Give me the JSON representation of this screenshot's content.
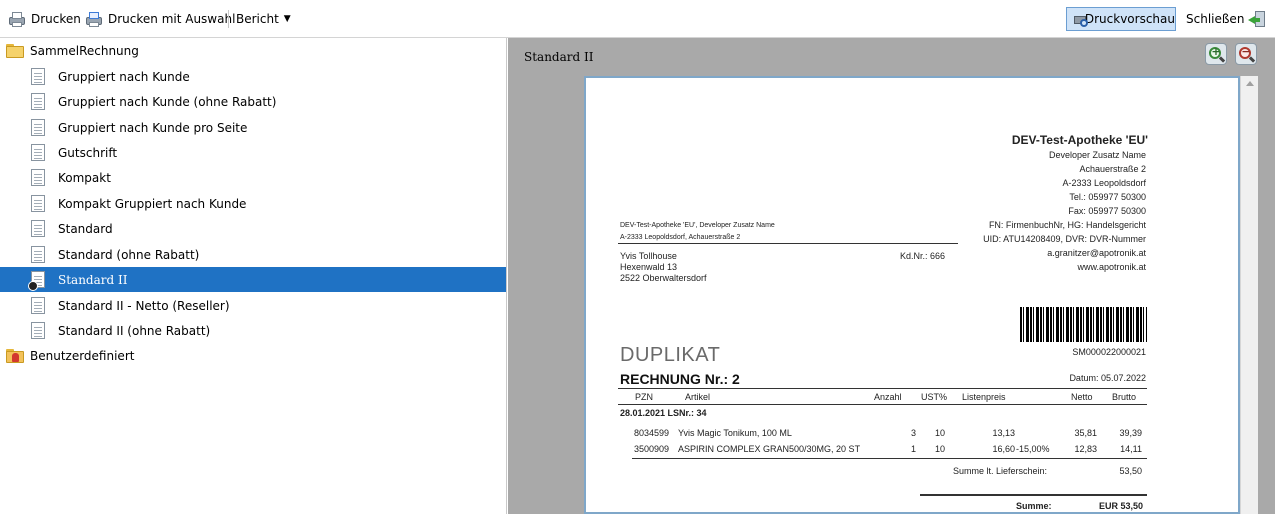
{
  "toolbar": {
    "print_label": "Drucken",
    "print_selection_label": "Drucken mit Auswahl",
    "report_label": "Bericht",
    "preview_label": "Druckvorschau",
    "close_label": "Schließen"
  },
  "tree": {
    "group_label": "SammelRechnung",
    "items": [
      "Gruppiert nach Kunde",
      "Gruppiert nach Kunde (ohne Rabatt)",
      "Gruppiert nach Kunde pro Seite",
      "Gutschrift",
      "Kompakt",
      "Kompakt Gruppiert nach Kunde",
      "Standard",
      "Standard (ohne Rabatt)",
      "Standard II",
      "Standard II - Netto (Reseller)",
      "Standard II (ohne Rabatt)"
    ],
    "selected": "Standard II",
    "user_group_label": "Benutzerdefiniert"
  },
  "preview": {
    "title": "Standard II"
  },
  "invoice": {
    "company": "DEV-Test-Apotheke 'EU'",
    "company_lines": [
      "Developer Zusatz Name",
      "Achauerstraße 2",
      "A-2333 Leopoldsdorf",
      "Tel.: 059977 50300",
      "Fax: 059977 50300",
      "FN: FirmenbuchNr, HG: Handelsgericht",
      "UID: ATU14208409, DVR: DVR-Nummer",
      "a.granitzer@apotronik.at",
      "www.apotronik.at"
    ],
    "sender_line": "DEV-Test-Apotheke 'EU', Developer Zusatz Name",
    "sender_address": "A-2333 Leopoldsdorf, Achauerstraße 2",
    "recipient": [
      "Yvis Tollhouse",
      "Hexenwald 13",
      "2522 Oberwaltersdorf"
    ],
    "customer_no": "Kd.Nr.: 666",
    "barcode_text": "SM000022000021",
    "duplicate": "DUPLIKAT",
    "invoice_title": "RECHNUNG Nr.: 2",
    "date": "Datum: 05.07.2022",
    "headers": [
      "PZN",
      "Artikel",
      "Anzahl",
      "UST%",
      "Listenpreis",
      "Netto",
      "Brutto"
    ],
    "delivery_header": "28.01.2021 LSNr.: 34",
    "rows": [
      {
        "pzn": "8034599",
        "article": "Yvis Magic Tonikum, 100 ML",
        "qty": "3",
        "vat": "10",
        "list_price": "13,13",
        "discount": "",
        "net": "35,81",
        "gross": "39,39"
      },
      {
        "pzn": "3500909",
        "article": "ASPIRIN COMPLEX GRAN500/30MG, 20 ST",
        "qty": "1",
        "vat": "10",
        "list_price": "16,60",
        "discount": "-15,00%",
        "net": "12,83",
        "gross": "14,11"
      }
    ],
    "subtotal_label": "Summe lt. Lieferschein:",
    "subtotal_value": "53,50",
    "total_label": "Summe:",
    "total_value": "EUR 53,50"
  }
}
